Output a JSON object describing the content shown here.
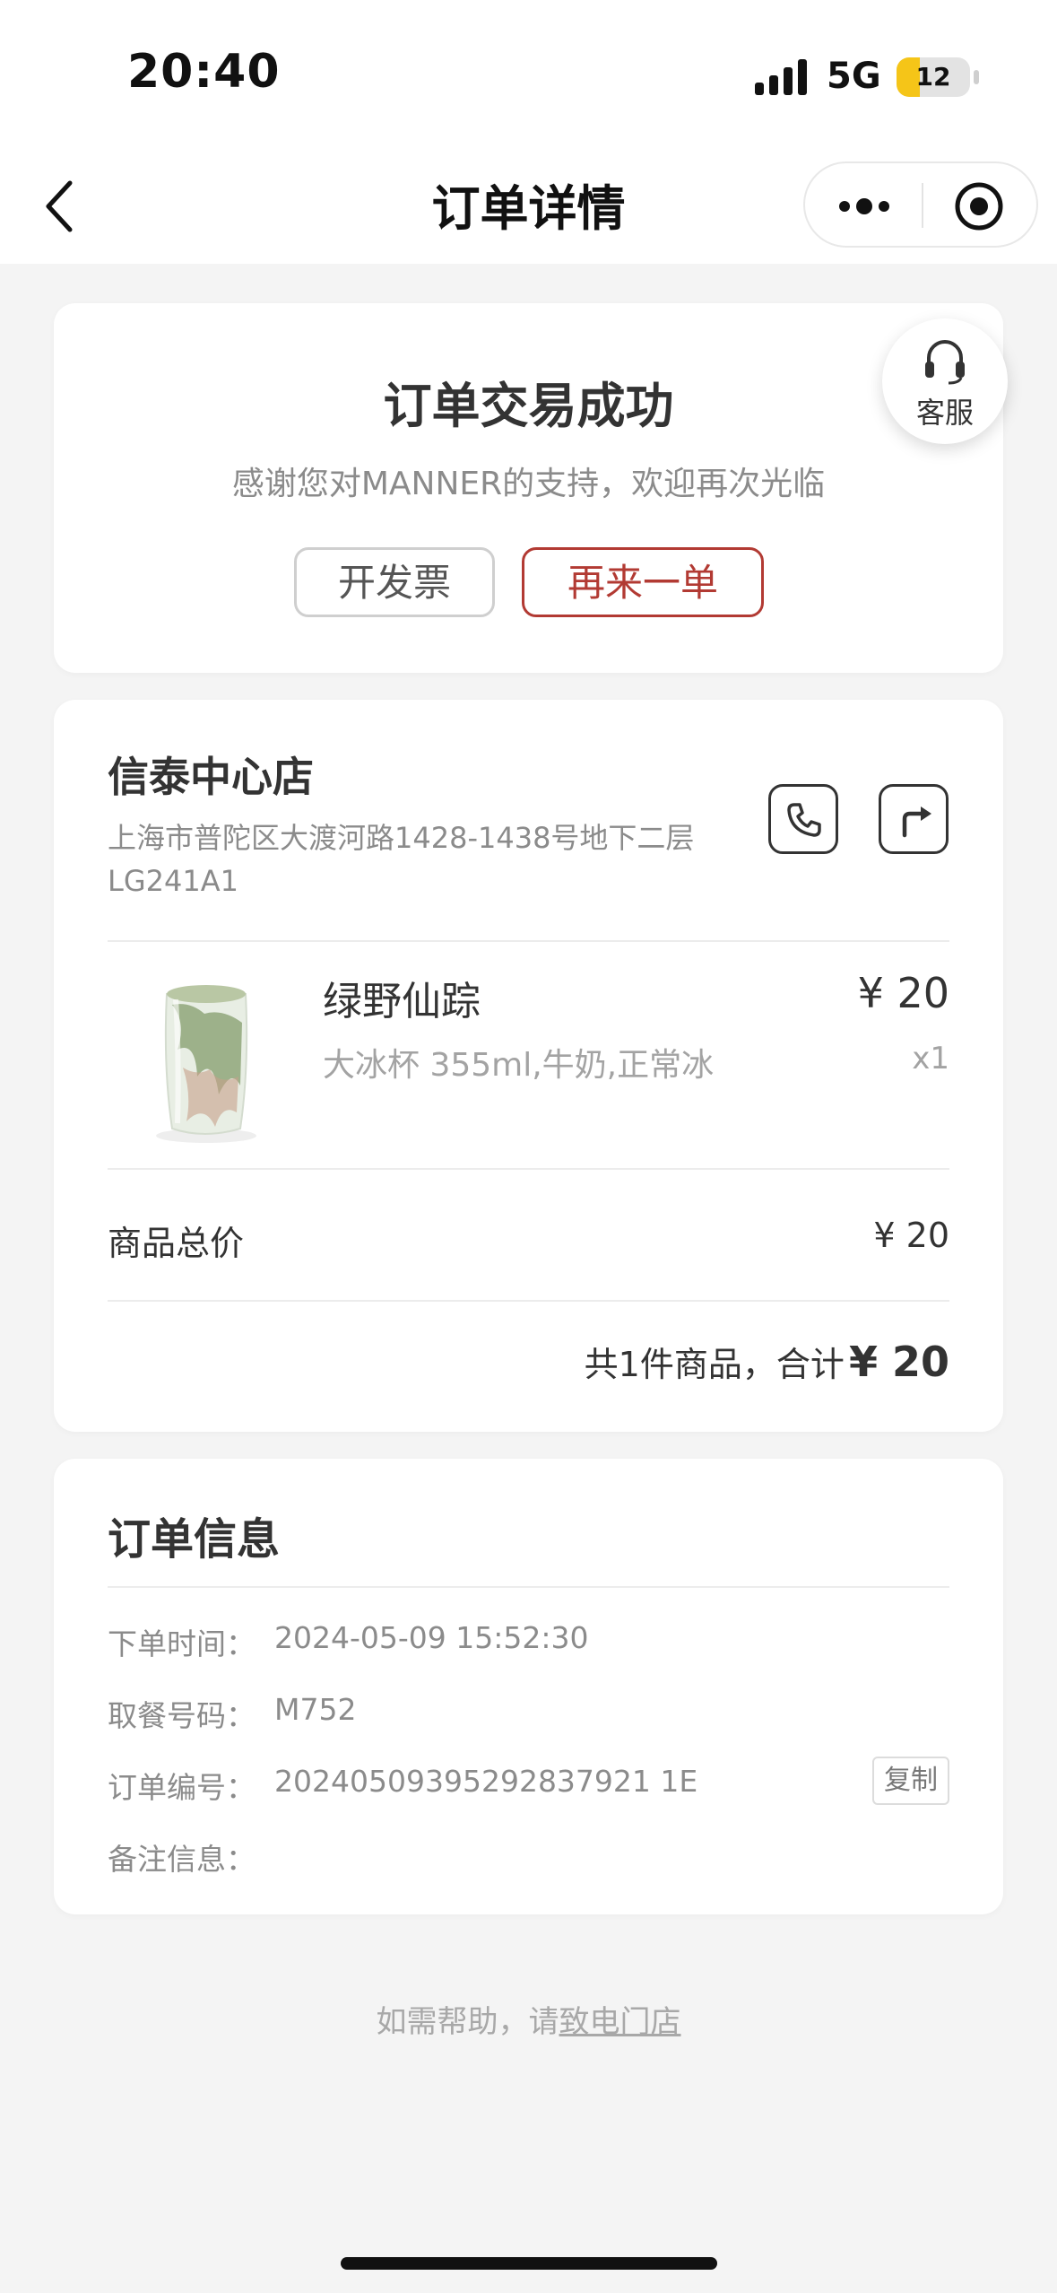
{
  "status_bar": {
    "time": "20:40",
    "network": "5G",
    "battery": "12",
    "battery_level": 0.12
  },
  "nav": {
    "title": "订单详情",
    "back_icon": "chevron-left-icon",
    "more_icon": "more-dots-icon",
    "close_icon": "target-close-icon"
  },
  "status_card": {
    "title": "订单交易成功",
    "message": "感谢您对MANNER的支持，欢迎再次光临",
    "invoice_button": "开发票",
    "reorder_button": "再来一单",
    "service_label": "客服",
    "service_icon": "headset-icon",
    "accent_color": "#b23a33"
  },
  "store": {
    "name": "信泰中心店",
    "address": "上海市普陀区大渡河路1428-1438号地下二层LG241A1",
    "call_icon": "phone-icon",
    "nav_icon": "directions-icon"
  },
  "product": {
    "name": "绿野仙踪",
    "spec": "大冰杯 355ml,牛奶,正常冰",
    "price": "¥ 20",
    "quantity": "x1"
  },
  "summary": {
    "subtotal_label": "商品总价",
    "subtotal_value": "¥ 20",
    "total_prefix": "共1件商品，合计",
    "total_value": "¥ 20"
  },
  "order_info": {
    "title": "订单信息",
    "rows": [
      {
        "label": "下单时间：",
        "value": "2024-05-09 15:52:30"
      },
      {
        "label": "取餐号码：",
        "value": "M752"
      },
      {
        "label": "订单编号：",
        "value": "20240509395292837921 1E"
      },
      {
        "label": "备注信息：",
        "value": ""
      }
    ],
    "copy_button": "复制"
  },
  "footer": {
    "help_prefix": "如需帮助，请",
    "help_link": "致电门店"
  }
}
